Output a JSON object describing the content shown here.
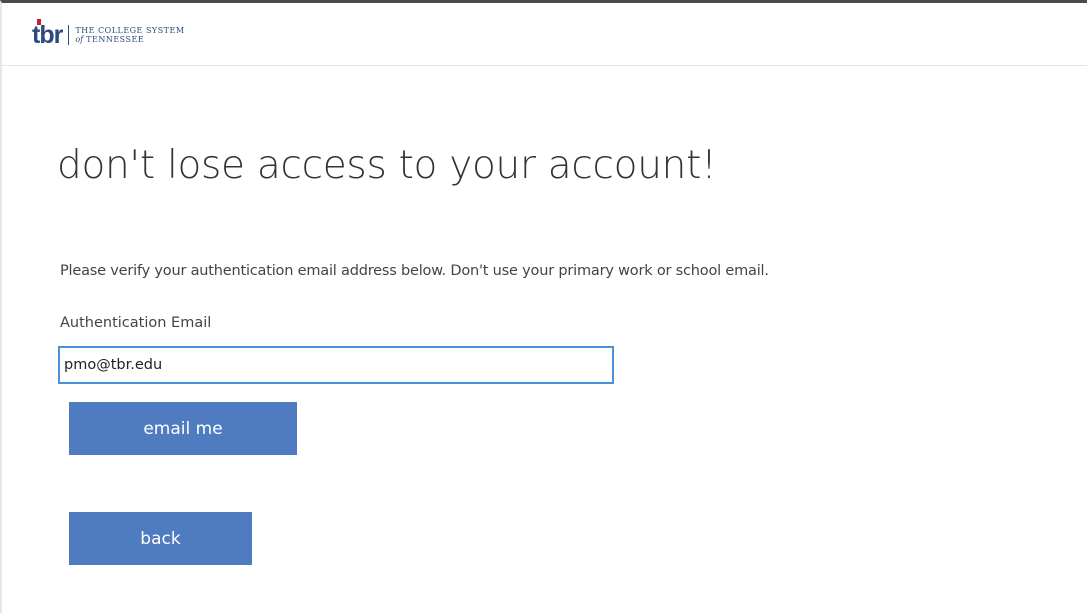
{
  "header": {
    "logo_mark": "tbr",
    "logo_line1": "THE COLLEGE SYSTEM",
    "logo_line2_of": "of",
    "logo_line2": "TENNESSEE"
  },
  "main": {
    "title": "don't lose access to your account!",
    "instructions": "Please verify your authentication email address below. Don't use your primary work or school email.",
    "email_label": "Authentication Email",
    "email_value": "pmo@tbr.edu",
    "email_button_label": "email me",
    "back_button_label": "back"
  },
  "colors": {
    "brand_navy": "#2c4a7e",
    "brand_red": "#c8202f",
    "button_blue": "#4f7cc0",
    "input_focus_border": "#4a90d9"
  }
}
